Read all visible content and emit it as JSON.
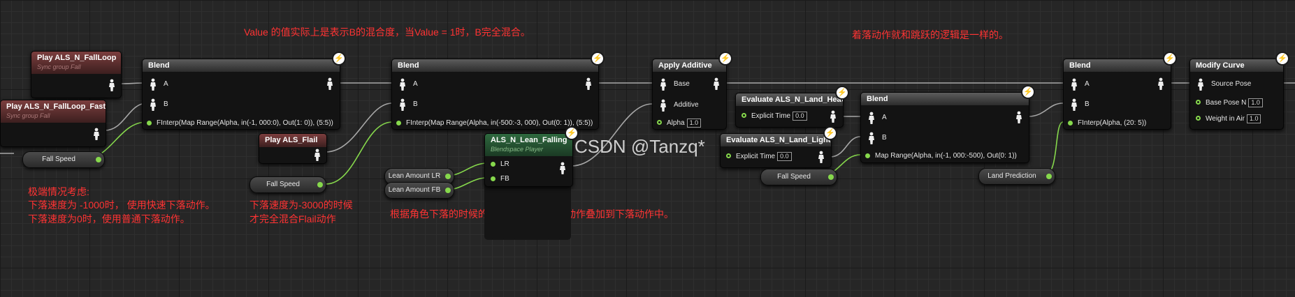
{
  "colors": {
    "pose_wire": "#a8a8a8",
    "float_wire": "#86d84c",
    "comment": "#ff3333"
  },
  "comments": {
    "top_left": "Value 的值实际上是表示B的混合度，当Value = 1时，B完全混合。",
    "top_right": "着落动作就和跳跃的逻辑是一样的。",
    "extreme_title": "极端情况考虑:",
    "extreme_line1": "下落速度为 -1000时，  使用快速下落动作。",
    "extreme_line2": "下落速度为0时，使用普通下落动作。",
    "flail_line1": "下落速度为-3000的时候",
    "flail_line2": "才完全混合Flail动作",
    "lean_note": "根据角色下落的时候的倾斜度选择对应的动作叠加到下落动作中。"
  },
  "watermark": "CSDN @Tanzq*",
  "nodes": {
    "fall_loop": {
      "title": "Play ALS_N_FallLoop",
      "sub": "Sync group Fall"
    },
    "fall_loop_fast": {
      "title": "Play ALS_N_FallLoop_Fast",
      "sub": "Sync group Fall"
    },
    "blend1": {
      "title": "Blend",
      "pin_a": "A",
      "pin_b": "B",
      "alpha": "FInterp(Map Range(Alpha, in(-1, 000:0), Out(1: 0)), (5:5))"
    },
    "play_flail": {
      "title": "Play ALS_Flail"
    },
    "blend2": {
      "title": "Blend",
      "pin_a": "A",
      "pin_b": "B",
      "alpha": "FInterp(Map Range(Alpha, in(-500:-3, 000), Out(0: 1)), (5:5))"
    },
    "lean_falling": {
      "title": "ALS_N_Lean_Falling",
      "sub": "Blendspace Player",
      "pin_lr": "LR",
      "pin_fb": "FB"
    },
    "apply_additive": {
      "title": "Apply Additive",
      "pin_base": "Base",
      "pin_additive": "Additive",
      "pin_alpha": "Alpha",
      "alpha_value": "1.0"
    },
    "land_heavy": {
      "title": "Evaluate ALS_N_Land_Heavy",
      "pin_time": "Explicit Time",
      "time_value": "0.0"
    },
    "land_light": {
      "title": "Evaluate ALS_N_Land_Light",
      "pin_time": "Explicit Time",
      "time_value": "0.0"
    },
    "blend3": {
      "title": "Blend",
      "pin_a": "A",
      "pin_b": "B",
      "alpha": "Map Range(Alpha, in(-1, 000:-500), Out(0: 1))"
    },
    "blend4": {
      "title": "Blend",
      "pin_a": "A",
      "pin_b": "B",
      "alpha": "FInterp(Alpha, (20: 5))"
    },
    "modify_curve": {
      "title": "Modify Curve",
      "pin_source": "Source Pose",
      "pin_base_pose": "Base Pose N",
      "base_pose_value": "1.0",
      "pin_weight": "Weight in Air",
      "weight_value": "1.0"
    }
  },
  "variables": {
    "fall_speed_1": "Fall Speed",
    "fall_speed_2": "Fall Speed",
    "fall_speed_3": "Fall Speed",
    "lean_lr": "Lean Amount LR",
    "lean_fb": "Lean Amount FB",
    "land_prediction": "Land Prediction"
  },
  "icons": {
    "pose": "person-silhouette-icon",
    "exec": "lightning-bolt-icon",
    "float_pin": "circle-pin-icon"
  }
}
